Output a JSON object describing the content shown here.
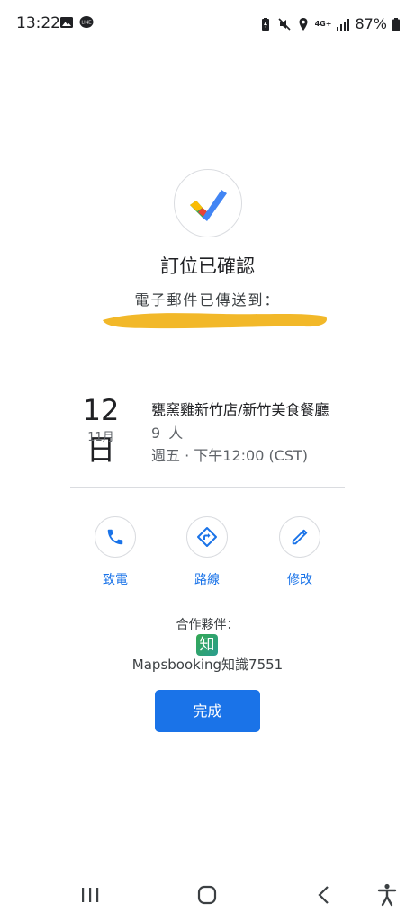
{
  "status_bar": {
    "time": "13:22",
    "network": "4G+",
    "battery": "87%",
    "left_icons": [
      "gallery-icon",
      "line-app-icon"
    ],
    "right_icons": [
      "battery-saver-icon",
      "mute-icon",
      "location-icon",
      "4g-icon",
      "signal-icon",
      "battery-icon"
    ]
  },
  "confirmation": {
    "title": "訂位已確認",
    "email_label": "電子郵件已傳送到："
  },
  "reservation": {
    "day": "12日",
    "month": "11月",
    "restaurant": "甕窯雞新竹店/新竹美食餐廳",
    "party_size": "9 人",
    "datetime": "週五 · 下午12:00 (CST)"
  },
  "actions": {
    "call": "致電",
    "directions": "路線",
    "edit": "修改"
  },
  "partner": {
    "label": "合作夥伴：",
    "logo_text": "知",
    "name": "Mapsbooking知識7551"
  },
  "done_button": "完成",
  "colors": {
    "accent": "#1a73e8",
    "redaction": "#f2b829"
  }
}
